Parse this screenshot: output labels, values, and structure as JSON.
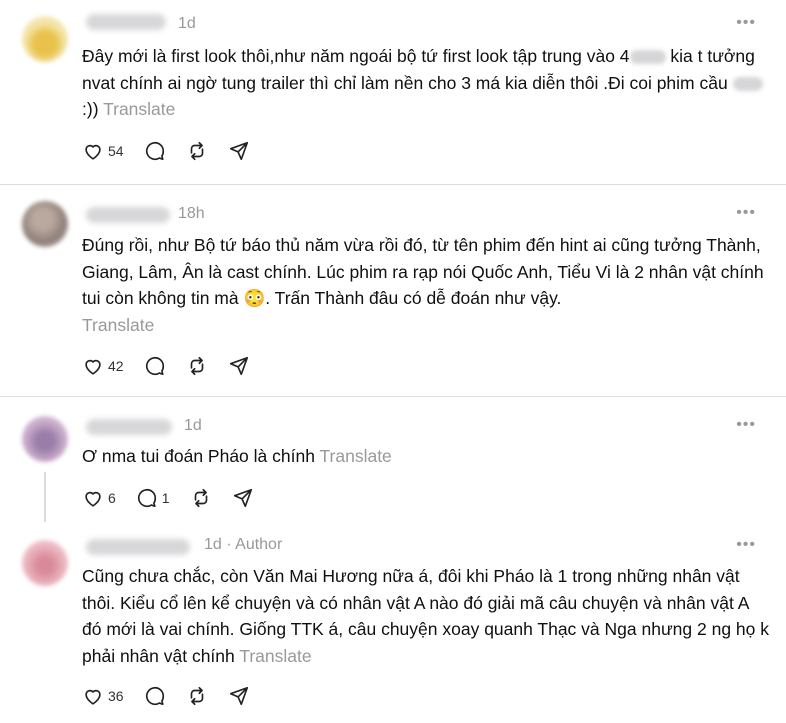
{
  "translate_label": "Translate",
  "more_label": "•••",
  "colors": {
    "text": "#101010",
    "muted": "#999999",
    "divider": "#dddddd"
  },
  "comments": [
    {
      "time": "1d",
      "text_1": "Đây mới là first look thôi,như năm ngoái bộ tứ first look tập trung vào 4",
      "text_2": " kia t tưởng nvat chính ai ngờ tung trailer thì chỉ làm nền cho 3 má kia diễn thôi .Đi coi phim cầu",
      "text_3": " :))",
      "likes": "54",
      "icons": [
        "heart-icon",
        "comment-icon",
        "repost-icon",
        "share-icon"
      ]
    },
    {
      "time": "18h",
      "text": "Đúng rồi, như Bộ tứ báo thủ năm vừa rồi đó, từ tên phim đến hint ai cũng tưởng Thành, Giang, Lâm, Ân là cast chính. Lúc phim ra rạp nói Quốc Anh, Tiểu Vi là 2 nhân vật chính tui còn không tin mà 😳. Trấn Thành đâu có dễ đoán như vậy.",
      "likes": "42"
    },
    {
      "time": "1d",
      "text": "Ơ nma tui đoán Pháo là chính",
      "likes": "6",
      "replies": "1"
    },
    {
      "time": "1d",
      "separator": "·",
      "author_label": "Author",
      "text": "Cũng chưa chắc, còn Văn Mai Hương nữa á, đôi khi Pháo là 1 trong những nhân vật thôi. Kiểu cổ lên kể chuyện và có nhân vật A nào đó giải mã câu chuyện và nhân vật A đó mới là vai chính. Giống TTK á, câu chuyện xoay quanh Thạc và Nga nhưng 2 ng họ k phải nhân vật chính",
      "likes": "36"
    }
  ]
}
